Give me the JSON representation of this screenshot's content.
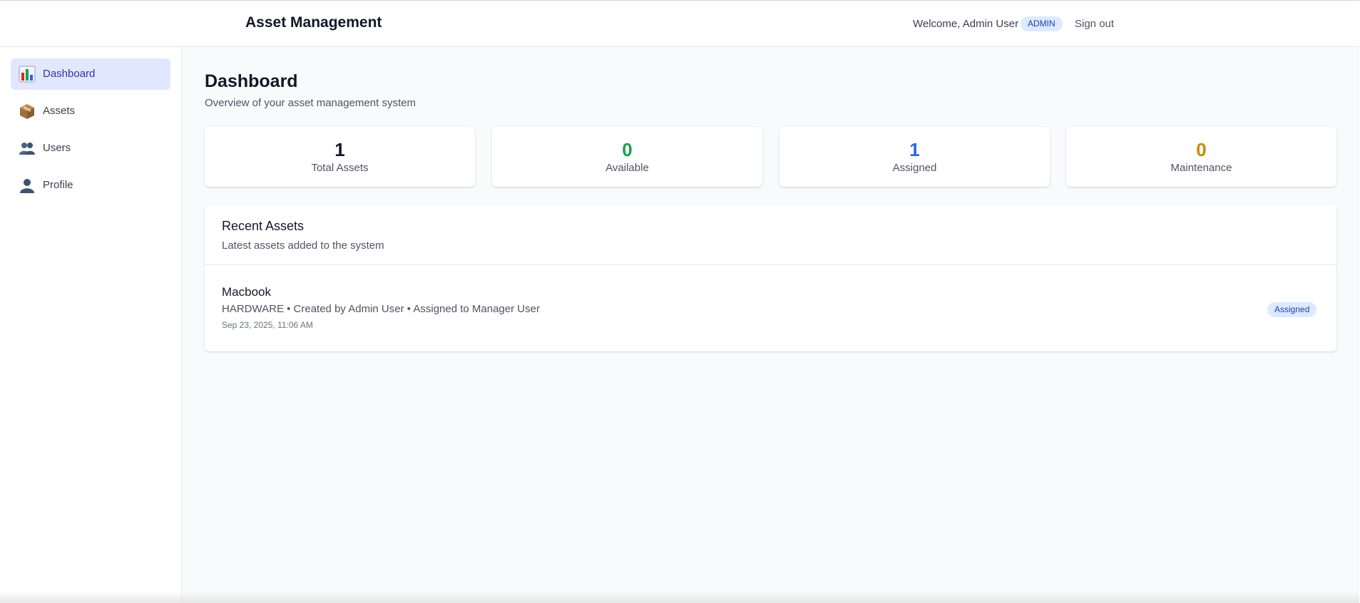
{
  "header": {
    "app_title": "Asset Management",
    "welcome_text": "Welcome, Admin User",
    "role_badge": "ADMIN",
    "signout_label": "Sign out"
  },
  "sidebar": {
    "items": [
      {
        "label": "Dashboard",
        "icon": "bar-chart-icon",
        "active": true
      },
      {
        "label": "Assets",
        "icon": "package-icon",
        "active": false
      },
      {
        "label": "Users",
        "icon": "users-icon",
        "active": false
      },
      {
        "label": "Profile",
        "icon": "user-icon",
        "active": false
      }
    ]
  },
  "main": {
    "title": "Dashboard",
    "subtitle": "Overview of your asset management system",
    "stats": [
      {
        "value": "1",
        "label": "Total Assets",
        "color": "#111827"
      },
      {
        "value": "0",
        "label": "Available",
        "color": "#16a34a"
      },
      {
        "value": "1",
        "label": "Assigned",
        "color": "#2563eb"
      },
      {
        "value": "0",
        "label": "Maintenance",
        "color": "#ca8a04"
      }
    ],
    "recent": {
      "title": "Recent Assets",
      "subtitle": "Latest assets added to the system",
      "items": [
        {
          "name": "Macbook",
          "meta": "HARDWARE • Created by Admin User • Assigned to Manager User",
          "date": "Sep 23, 2025, 11:06 AM",
          "status": "Assigned"
        }
      ]
    }
  },
  "colors": {
    "accent": "#3730a3",
    "active_nav_bg": "#e0e7ff",
    "badge_bg": "#dbeafe",
    "badge_text": "#1e40af"
  }
}
